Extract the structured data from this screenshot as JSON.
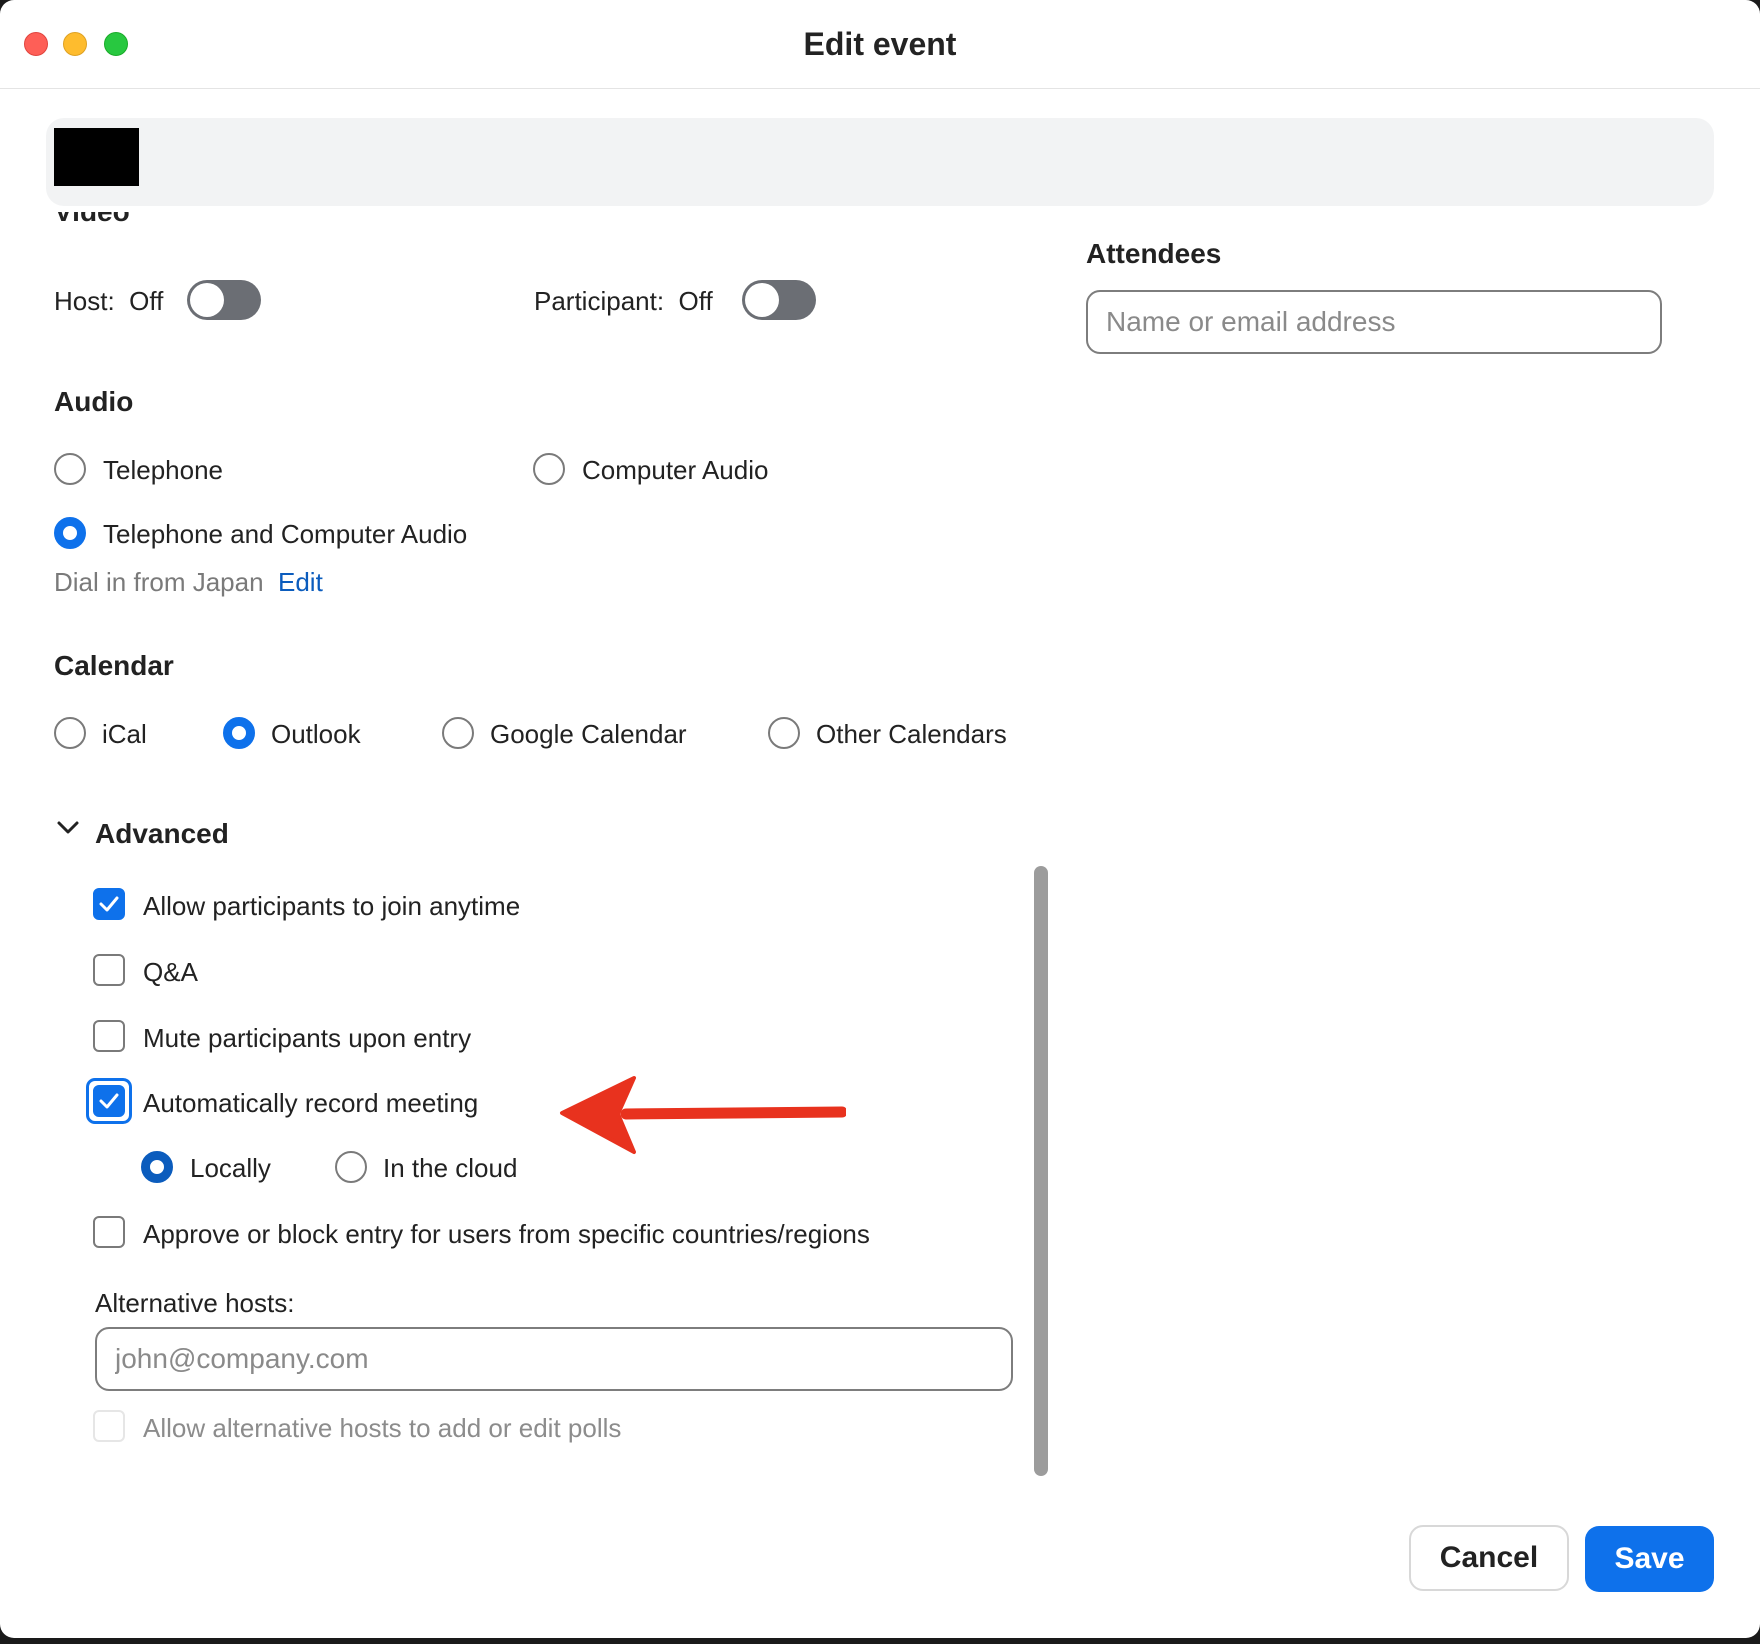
{
  "window": {
    "title": "Edit event"
  },
  "video": {
    "heading": "Video",
    "host_label": "Host:",
    "host_value": "Off",
    "participant_label": "Participant:",
    "participant_value": "Off"
  },
  "attendees": {
    "heading": "Attendees",
    "placeholder": "Name or email address"
  },
  "audio": {
    "heading": "Audio",
    "options": [
      "Telephone",
      "Computer Audio",
      "Telephone and Computer Audio"
    ],
    "selected": "Telephone and Computer Audio",
    "dial_in_text": "Dial in from Japan",
    "edit_link": "Edit"
  },
  "calendar": {
    "heading": "Calendar",
    "options": [
      "iCal",
      "Outlook",
      "Google Calendar",
      "Other Calendars"
    ],
    "selected": "Outlook"
  },
  "advanced": {
    "heading": "Advanced",
    "options": [
      {
        "label": "Allow participants to join anytime",
        "checked": true
      },
      {
        "label": "Q&A",
        "checked": false
      },
      {
        "label": "Mute participants upon entry",
        "checked": false
      },
      {
        "label": "Automatically record meeting",
        "checked": true
      },
      {
        "label": "Approve or block entry for users from specific countries/regions",
        "checked": false
      }
    ],
    "record_locations": [
      "Locally",
      "In the cloud"
    ],
    "record_selected": "Locally",
    "alt_hosts_label": "Alternative hosts:",
    "alt_hosts_placeholder": "john@company.com",
    "alt_hosts_polls_label": "Allow alternative hosts to add or edit polls"
  },
  "buttons": {
    "cancel": "Cancel",
    "save": "Save"
  },
  "colors": {
    "accent": "#0e71eb",
    "annotation": "#e8321e"
  }
}
